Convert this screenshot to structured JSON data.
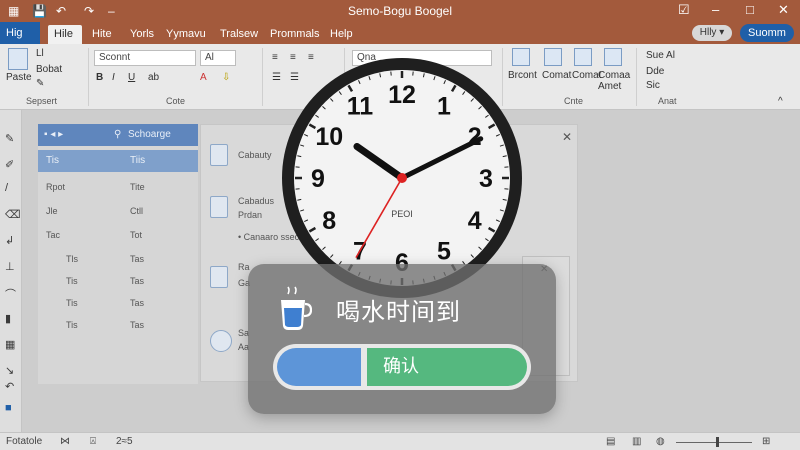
{
  "window": {
    "title": "Semo-Bogu Boogel",
    "pill_button": "Hlly ▾",
    "account_button": "Suomm"
  },
  "tabs": [
    "Hig",
    "Hile",
    "Hite",
    "Yorls",
    "Yymavu",
    "Tralsew",
    "Prommals",
    "Help"
  ],
  "ribbon": {
    "paste_label": "Paste",
    "clipboard_items": [
      "Ll",
      "Bobat"
    ],
    "clipboard_group": "Sepsert",
    "font_name": "Sconnt",
    "font_size": "Al",
    "font_group": "Cote",
    "style_box": "Qna",
    "styles": [
      "Brcont",
      "Comat",
      "Comat",
      "Comaa Amet"
    ],
    "styles_group": "Cnte",
    "editing_items": [
      "Sue Al",
      "Dde",
      "Sic"
    ],
    "editing_group": "Anat"
  },
  "left_panel": {
    "header": "Schoarge",
    "selected": "Tis",
    "selected_right": "Tiis",
    "row1_left": "Rpot",
    "row1_right": "Tite",
    "rows": [
      "Jle",
      "Tac",
      "Tls",
      "Tis",
      "Tis",
      "Tis",
      "Tis"
    ],
    "rows_right": [
      "Ctll",
      "Tot",
      "Tas",
      "Tas",
      "Tas",
      "Tas"
    ]
  },
  "main_panel": {
    "item1": "Cabauty",
    "item2_title": "Cabadus",
    "item2_sub": "Prdan",
    "item2_meta": "• Canaaro ssecoo",
    "item3_title": "Ra",
    "item3_sub": "Ga",
    "item4_title": "Sa",
    "item4_sub": "Aa"
  },
  "clock": {
    "numbers": [
      "12",
      "1",
      "2",
      "3",
      "4",
      "5",
      "6",
      "7",
      "8",
      "9",
      "10",
      "11"
    ],
    "brand": "PEOI",
    "time": {
      "hour": 10,
      "minute": 10,
      "second": 35
    }
  },
  "reminder": {
    "message": "喝水时间到",
    "confirm_label": "确认"
  },
  "statusbar": {
    "page": "Fotatole",
    "words": "2≈5"
  }
}
